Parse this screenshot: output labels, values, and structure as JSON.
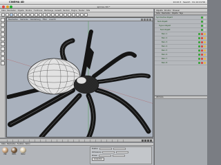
{
  "menubar": {
    "app_name": "CINEMA 4D",
    "status": [
      "10:22:3",
      "Search",
      "Do 12:21:56"
    ]
  },
  "window": {
    "title": "spinne.c4d *"
  },
  "app_menu": [
    "Datei",
    "Bearbeiten",
    "Objekte",
    "Struktur",
    "Funktionen",
    "Werkzeuge",
    "Auswahl",
    "Rendern",
    "Plugins",
    "Fenster",
    "Hilfe"
  ],
  "viewport": {
    "header_items": [
      "Bearbeiten",
      "Kameras",
      "Darstellung",
      "Filter",
      "Ansicht"
    ],
    "model_colors": {
      "background": "#a9b1bd",
      "wire": "#1b1b1b",
      "body": "#e2e2e2"
    }
  },
  "right_panel": {
    "tabs": [
      "Objekte",
      "Struktur",
      "Browser"
    ],
    "menu": [
      "Datei",
      "Bearbeiten",
      "Objekte",
      "Tags"
    ],
    "objects": [
      {
        "name": "Symmetrie-Objekt"
      },
      {
        "name": "Null-Objekt"
      },
      {
        "name": "Hyper-Objekt"
      },
      {
        "name": "Null-Objekt"
      },
      {
        "name": "Bein 1"
      },
      {
        "name": "Bein 2"
      },
      {
        "name": "Bein 3"
      },
      {
        "name": "Bein 4"
      },
      {
        "name": "Bein 5"
      },
      {
        "name": "Bein 6"
      },
      {
        "name": "Bein 7"
      },
      {
        "name": "Bein 8"
      }
    ],
    "attr_title": "Attribute"
  },
  "bottom": {
    "materials_menu": [
      "Datei",
      "Bearbeiten",
      "Funktion",
      "Textur"
    ],
    "materials": [
      {
        "label": "Mat",
        "color": "#c9a27a"
      },
      {
        "label": "Mat.1",
        "color": "#7a5a3a"
      },
      {
        "label": "Mat.2",
        "color": "#d8c8a8"
      }
    ],
    "coords": {
      "rows": [
        {
          "label": "Position",
          "axes": [
            "X",
            "Y",
            "Z"
          ]
        },
        {
          "label": "Abmessung",
          "axes": [
            "X",
            "Y",
            "Z"
          ]
        },
        {
          "label": "Winkel",
          "axes": [
            "H",
            "P",
            "B"
          ]
        }
      ],
      "apply": "Anwenden"
    }
  }
}
